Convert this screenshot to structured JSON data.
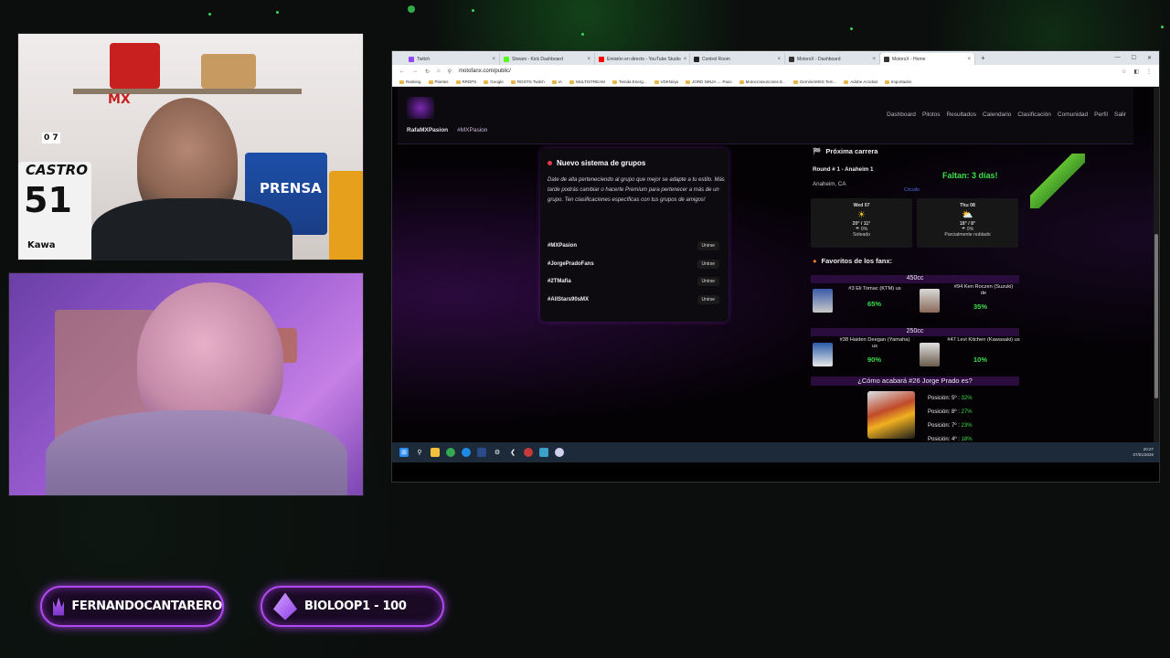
{
  "colors": {
    "accent_green": "#3ddf4a",
    "accent_purple": "#b04af0",
    "category_bar": "#2a0d3c"
  },
  "cam1": {
    "plate": "PRENSA",
    "racer_name": "CASTRO",
    "racer_number": "51",
    "sponsor": "Kawa",
    "brand_tag": "MX",
    "digits": "0 7"
  },
  "browser": {
    "tabs": [
      {
        "label": "Twitch",
        "color": "#9146ff",
        "active": false
      },
      {
        "label": "Stream - Kick Dashboard",
        "color": "#53fc18",
        "active": false
      },
      {
        "label": "Emisión en directo - YouTube Studio",
        "color": "#ff0000",
        "active": false
      },
      {
        "label": "Control Room",
        "color": "#222222",
        "active": false
      },
      {
        "label": "MotorsX - Dashboard",
        "color": "#333333",
        "active": false
      },
      {
        "label": "MotorsX - Home",
        "color": "#333333",
        "active": true
      }
    ],
    "url": "motofanx.com/public/",
    "bookmarks": [
      "Ranking",
      "Plantes",
      "RRDPS",
      "Google",
      "ROOTS Twitch",
      "IA",
      "MULTISTREAM",
      "Tienda Energ...",
      "VDKNinja",
      "JORD NINJA ← Paso",
      "Motocrossoncines E...",
      "GeminiAMSS Tem...",
      "Adobe Acrobat",
      "Importados"
    ]
  },
  "site": {
    "user": "RafaMXPasion",
    "hashtag": "#MXPasion",
    "nav": [
      "Dashboard",
      "Pilotos",
      "Resultados",
      "Calendario",
      "Clasificación",
      "Comunidad",
      "Perfil",
      "Salir"
    ],
    "groups": {
      "title": "Nuevo sistema de grupos",
      "description": "Date de alta perteneciendo al grupo que mejor se adapte a tu estilo. Más tarde podrás cambiar o hacerte Premium para pertenecer a más de un grupo. Ten clasificaciones específicas con tus grupos de amigos!",
      "items": [
        {
          "name": "#MXPasion",
          "action": "Unirse"
        },
        {
          "name": "#JorgePradoFans",
          "action": "Unirse"
        },
        {
          "name": "#2TMafia",
          "action": "Unirse"
        },
        {
          "name": "#AllStars90sMX",
          "action": "Unirse"
        }
      ]
    },
    "next_race": {
      "heading": "Próxima carrera",
      "round": "Round # 1 - Anaheim 1",
      "location": "Anaheim, CA",
      "countdown": "Faltan: 3 días!",
      "broken_img": "Circuito",
      "weather": [
        {
          "day": "Wed 07",
          "icon": "sun-icon",
          "temp": "20° / 11°",
          "rain": "0%",
          "desc": "Soleado"
        },
        {
          "day": "Thu 08",
          "icon": "partly-cloudy-icon",
          "temp": "18° / 8°",
          "rain": "0%",
          "desc": "Parcialmente nublado"
        }
      ]
    },
    "favorites": {
      "heading": "Favoritos de los fanx:",
      "cat450": "450cc",
      "m450": {
        "left_name": "#3 Eli Tomac (KTM) us",
        "left_pct": "65%",
        "right_name": "#94 Ken Roczen (Suzuki)",
        "right_flag": "de",
        "right_pct": "35%"
      },
      "cat250": "250cc",
      "m250": {
        "left_name": "#38 Haiden Deegan (Yamaha) us",
        "left_pct": "90%",
        "right_name": "#47 Levi Kitchen (Kawasaki) us",
        "right_pct": "10%"
      }
    },
    "prado": {
      "question": "¿Cómo acabará #26 Jorge Prado es?",
      "options": [
        {
          "label": "Posición: 5º :",
          "pct": "32%"
        },
        {
          "label": "Posición: 8º :",
          "pct": "27%"
        },
        {
          "label": "Posición: 7º :",
          "pct": "23%"
        },
        {
          "label": "Posición: 4º :",
          "pct": "18%"
        }
      ]
    }
  },
  "taskbar": {
    "time": "20:27",
    "date": "07/01/2026"
  },
  "badges": {
    "follower": "FERNANDOCANTARERO",
    "sub": "BIOLOOP1 - 100"
  }
}
